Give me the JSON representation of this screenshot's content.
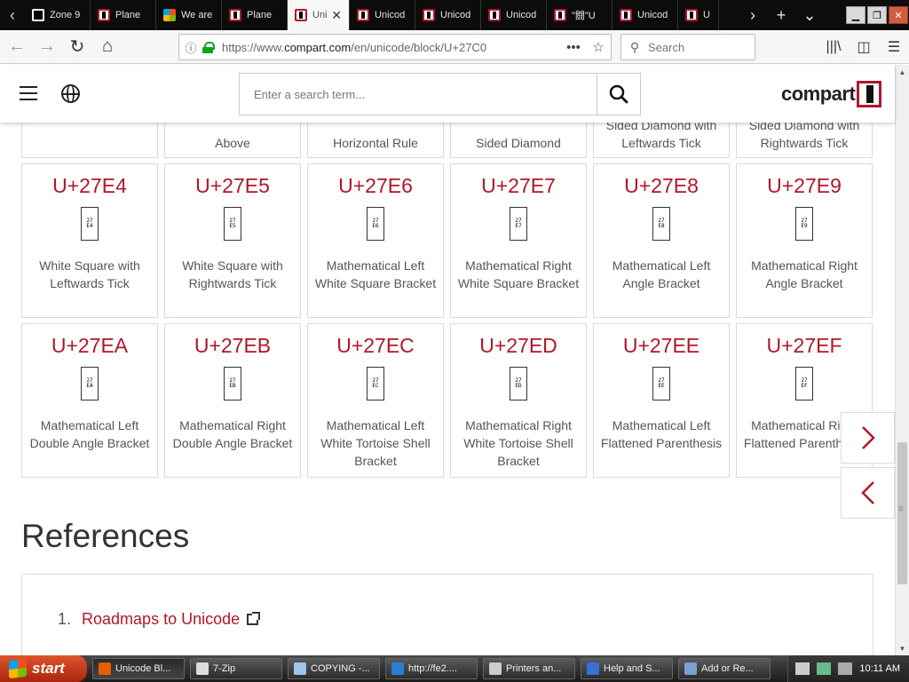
{
  "browser": {
    "tabs": [
      {
        "label": "Zone 9",
        "favicon": "zone-favicon",
        "active": false
      },
      {
        "label": "Plane ",
        "favicon": "compart-favicon",
        "active": false
      },
      {
        "label": "We are",
        "favicon": "microsoft-favicon",
        "active": false
      },
      {
        "label": "Plane ",
        "favicon": "compart-favicon",
        "active": false
      },
      {
        "label": "Uni",
        "favicon": "compart-favicon",
        "active": true
      },
      {
        "label": "Unicod",
        "favicon": "compart-favicon",
        "active": false
      },
      {
        "label": "Unicod",
        "favicon": "compart-favicon",
        "active": false
      },
      {
        "label": "Unicod",
        "favicon": "compart-favicon",
        "active": false
      },
      {
        "label": "\"闘\"U",
        "favicon": "compart-favicon",
        "active": false
      },
      {
        "label": "Unicod",
        "favicon": "compart-favicon",
        "active": false
      },
      {
        "label": "U",
        "favicon": "compart-favicon",
        "active": false
      }
    ],
    "url_prefix": "https://www.",
    "url_domain": "compart.com",
    "url_path": "/en/unicode/block/U+27C0",
    "search_placeholder": "Search"
  },
  "site": {
    "search_placeholder": "Enter a search term...",
    "logo_text": "compart"
  },
  "partial_row": [
    {
      "name": ""
    },
    {
      "name": "Above"
    },
    {
      "name": "Horizontal Rule"
    },
    {
      "name": "Sided Diamond"
    },
    {
      "name": "Sided Diamond with Leftwards Tick"
    },
    {
      "name": "Sided Diamond with Rightwards Tick"
    }
  ],
  "row1": [
    {
      "code": "U+27E4",
      "hex_top": "27",
      "hex_bot": "E4",
      "name": "White Square with Leftwards Tick"
    },
    {
      "code": "U+27E5",
      "hex_top": "27",
      "hex_bot": "E5",
      "name": "White Square with Rightwards Tick"
    },
    {
      "code": "U+27E6",
      "hex_top": "27",
      "hex_bot": "E6",
      "name": "Mathematical Left White Square Bracket"
    },
    {
      "code": "U+27E7",
      "hex_top": "27",
      "hex_bot": "E7",
      "name": "Mathematical Right White Square Bracket"
    },
    {
      "code": "U+27E8",
      "hex_top": "27",
      "hex_bot": "E8",
      "name": "Mathematical Left Angle Bracket"
    },
    {
      "code": "U+27E9",
      "hex_top": "27",
      "hex_bot": "E9",
      "name": "Mathematical Right Angle Bracket"
    }
  ],
  "row2": [
    {
      "code": "U+27EA",
      "hex_top": "27",
      "hex_bot": "EA",
      "name": "Mathematical Left Double Angle Bracket"
    },
    {
      "code": "U+27EB",
      "hex_top": "27",
      "hex_bot": "EB",
      "name": "Mathematical Right Double Angle Bracket"
    },
    {
      "code": "U+27EC",
      "hex_top": "27",
      "hex_bot": "EC",
      "name": "Mathematical Left White Tortoise Shell Bracket"
    },
    {
      "code": "U+27ED",
      "hex_top": "27",
      "hex_bot": "ED",
      "name": "Mathematical Right White Tortoise Shell Bracket"
    },
    {
      "code": "U+27EE",
      "hex_top": "27",
      "hex_bot": "EE",
      "name": "Mathematical Left Flattened Parenthesis"
    },
    {
      "code": "U+27EF",
      "hex_top": "27",
      "hex_bot": "EF",
      "name": "Mathematical Right Flattened Parenthesis"
    }
  ],
  "references": {
    "title": "References",
    "items": [
      {
        "number": "1.",
        "label": "Roadmaps to Unicode"
      }
    ]
  },
  "taskbar": {
    "start_label": "start",
    "tasks": [
      {
        "label": "Unicode Bl...",
        "icon": "firefox-icon"
      },
      {
        "label": "7-Zip",
        "icon": "7zip-icon"
      },
      {
        "label": "COPYING -...",
        "icon": "notepad-icon"
      },
      {
        "label": "http://fe2....",
        "icon": "ie-icon"
      },
      {
        "label": "Printers an...",
        "icon": "printer-icon"
      },
      {
        "label": "Help and S...",
        "icon": "help-icon"
      },
      {
        "label": "Add or Re...",
        "icon": "add-remove-icon"
      }
    ],
    "clock": "10:11 AM"
  },
  "colors": {
    "accent": "#b0182a",
    "text": "#555555"
  }
}
